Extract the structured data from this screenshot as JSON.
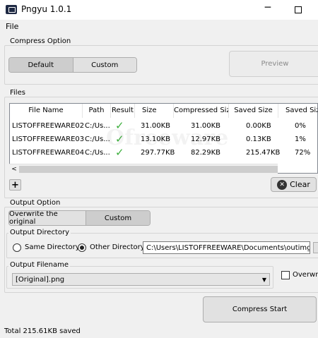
{
  "window": {
    "title": "Pngyu 1.0.1",
    "min_glyph": "─"
  },
  "menu": {
    "file": "File"
  },
  "compress_option": {
    "legend": "Compress Option",
    "default_label": "Default",
    "custom_label": "Custom",
    "preview_label": "Preview"
  },
  "files": {
    "legend": "Files",
    "columns": [
      "File Name",
      "Path",
      "Result",
      "Size",
      "Compressed Size",
      "Saved Size",
      "Saved Size"
    ],
    "rows": [
      {
        "name": "LISTOFFREEWARE02",
        "path": "C:/Us...",
        "size": "31.00KB",
        "compressed": "31.00KB",
        "saved": "0.00KB",
        "saved_pct": "0%"
      },
      {
        "name": "LISTOFFREEWARE03",
        "path": "C:/Us...",
        "size": "13.10KB",
        "compressed": "12.97KB",
        "saved": "0.13KB",
        "saved_pct": "1%"
      },
      {
        "name": "LISTOFFREEWARE04",
        "path": "C:/Us...",
        "size": "297.77KB",
        "compressed": "82.29KB",
        "saved": "215.47KB",
        "saved_pct": "72%"
      }
    ],
    "result_glyph": "✓",
    "add_glyph": "+",
    "clear_label": "Clear",
    "clear_icon_glyph": "✕",
    "watermark": "Ofreeware"
  },
  "output_option": {
    "legend": "Output Option",
    "overwrite_label": "Overwrite the original",
    "custom_label": "Custom",
    "directory_legend": "Output Directory",
    "same_dir_label": "Same Directory",
    "other_dir_label": "Other Directory",
    "directory_value": "C:\\Users\\LISTOFFREEWARE\\Documents\\outimg",
    "filename_legend": "Output Filename",
    "filename_value": "[Original].png",
    "overwrite_check_label": "Overwrite"
  },
  "actions": {
    "compress_start_label": "Compress Start"
  },
  "status": {
    "text": "Total 215.61KB saved"
  },
  "colors": {
    "check_green": "#3cae3c",
    "selected_segment": "#cdcdcd"
  }
}
